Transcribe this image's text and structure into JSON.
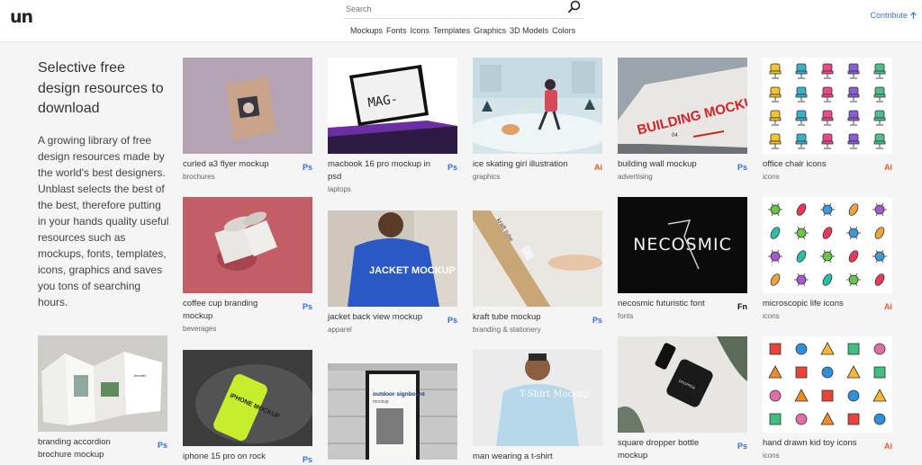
{
  "header": {
    "logo": "un",
    "search_placeholder": "Search",
    "nav": [
      "Mockups",
      "Fonts",
      "Icons",
      "Templates",
      "Graphics",
      "3D Models",
      "Colors"
    ],
    "contribute": "Contribute"
  },
  "intro": {
    "title": "Selective free design resources to download",
    "body": "A growing library of free design resources made by the world's best designers. Unblast selects the best of the best, therefore putting in your hands quality useful resources such as mockups, fonts, templates, icons, graphics and saves you tons of searching hours."
  },
  "cards": [
    {
      "title": "curled a3 flyer mockup",
      "category": "brochures",
      "badge": "Ps"
    },
    {
      "title": "macbook 16 pro mockup in psd",
      "category": "laptops",
      "badge": "Ps"
    },
    {
      "title": "ice skating girl illustration",
      "category": "graphics",
      "badge": "Ai"
    },
    {
      "title": "building wall mockup",
      "category": "advertising",
      "badge": "Ps"
    },
    {
      "title": "office chair icons",
      "category": "icons",
      "badge": "Ai"
    },
    {
      "title": "coffee cup branding mockup",
      "category": "beverages",
      "badge": "Ps"
    },
    {
      "title": "jacket back view mockup",
      "category": "apparel",
      "badge": "Ps"
    },
    {
      "title": "kraft tube mockup",
      "category": "branding & stationery",
      "badge": "Ps"
    },
    {
      "title": "necosmic futuristic font",
      "category": "fonts",
      "badge": "Fn"
    },
    {
      "title": "microscopic life icons",
      "category": "icons",
      "badge": "Ai"
    },
    {
      "title": "branding accordion brochure mockup",
      "category": "",
      "badge": "Ps"
    },
    {
      "title": "iphone 15 pro on rock",
      "category": "",
      "badge": "Ps"
    },
    {
      "title": "",
      "category": "",
      "badge": ""
    },
    {
      "title": "man wearing a t-shirt",
      "category": "",
      "badge": ""
    },
    {
      "title": "square dropper bottle mockup",
      "category": "",
      "badge": "Ps"
    },
    {
      "title": "hand drawn kid toy icons",
      "category": "icons",
      "badge": "Ai"
    }
  ],
  "thumb_text": {
    "mac": "MAG-",
    "building": "BUILDING MOCKUP",
    "building_num": "04",
    "jacket": "JACKET MOCKUP",
    "necosmic": "NECOSMIC",
    "kraft": "kraft tube",
    "iphone": "iPHONE MOCKUP",
    "signboard": "outdoor signboard",
    "signboard_sub": "mockup",
    "tshirt": "T-Shirt Mockup",
    "dropper": "DROPPER"
  },
  "colors": {
    "accent": "#3d72d8",
    "ps": "#2f6fe0",
    "ai": "#e8562a"
  }
}
